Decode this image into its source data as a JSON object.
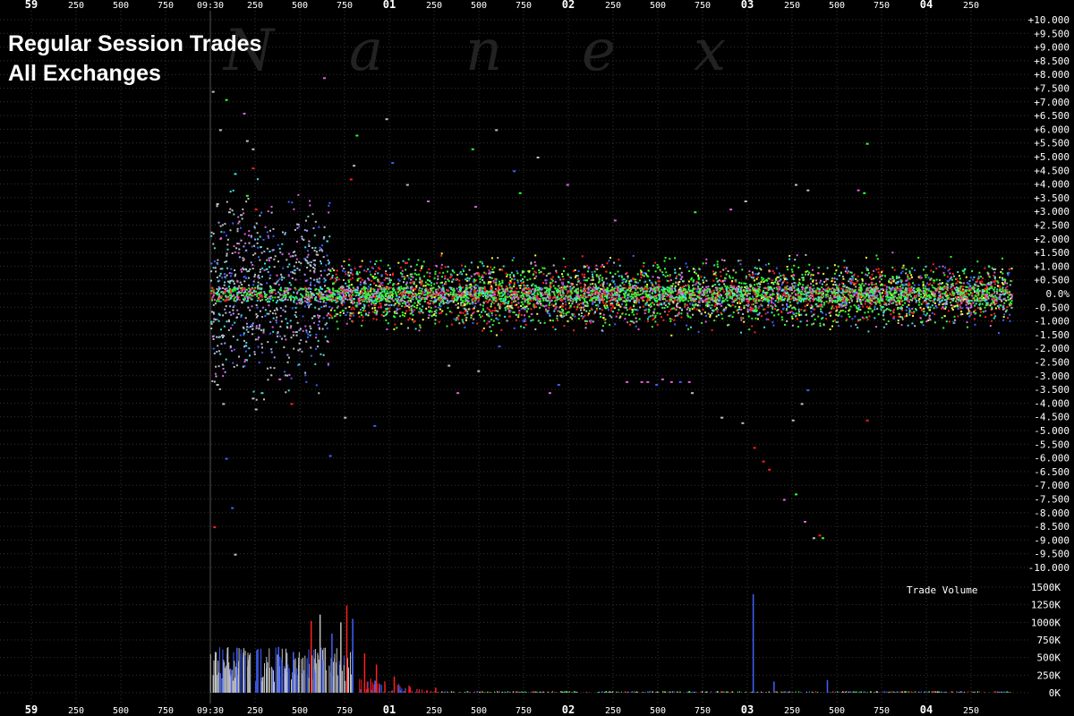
{
  "title_lines": [
    "Regular Session Trades",
    "All Exchanges"
  ],
  "watermark": [
    "N",
    "a",
    "n",
    "e",
    "x"
  ],
  "colors": {
    "background": "#000000",
    "grid": "#333333",
    "axis_text": "#ffffff",
    "trade_colors": [
      "#ff2020",
      "#30ff30",
      "#c0c0c0",
      "#4060ff",
      "#e060e0",
      "#40e0e0",
      "#ffff40",
      "#ff9030",
      "#a0a0ff"
    ]
  },
  "time_axis": {
    "labels": [
      {
        "text": "59",
        "bold": true
      },
      {
        "text": "250",
        "bold": false
      },
      {
        "text": "500",
        "bold": false
      },
      {
        "text": "750",
        "bold": false
      },
      {
        "text": "09:30",
        "bold": false
      },
      {
        "text": "250",
        "bold": false
      },
      {
        "text": "500",
        "bold": false
      },
      {
        "text": "750",
        "bold": false
      },
      {
        "text": "01",
        "bold": true
      },
      {
        "text": "250",
        "bold": false
      },
      {
        "text": "500",
        "bold": false
      },
      {
        "text": "750",
        "bold": false
      },
      {
        "text": "02",
        "bold": true
      },
      {
        "text": "250",
        "bold": false
      },
      {
        "text": "500",
        "bold": false
      },
      {
        "text": "750",
        "bold": false
      },
      {
        "text": "03",
        "bold": true
      },
      {
        "text": "250",
        "bold": false
      },
      {
        "text": "500",
        "bold": false
      },
      {
        "text": "750",
        "bold": false
      },
      {
        "text": "04",
        "bold": true
      },
      {
        "text": "250",
        "bold": false
      }
    ]
  },
  "chart_data": [
    {
      "type": "scatter",
      "title": "Regular Session Trades",
      "subtitle": "All Exchanges",
      "x_range_seconds_after_0930": [
        0,
        270
      ],
      "ylim": [
        -10,
        10
      ],
      "y_unit": "%",
      "y_tick_labels": [
        "+10.000",
        "+9.500",
        "+9.000",
        "+8.500",
        "+8.000",
        "+7.500",
        "+7.000",
        "+6.500",
        "+6.000",
        "+5.500",
        "+5.000",
        "+4.500",
        "+4.000",
        "+3.500",
        "+3.000",
        "+2.500",
        "+2.000",
        "+1.500",
        "+1.000",
        "+0.500",
        "0.0%",
        "-0.500",
        "-1.000",
        "-1.500",
        "-2.000",
        "-2.500",
        "-3.000",
        "-3.500",
        "-4.000",
        "-4.500",
        "-5.000",
        "-5.500",
        "-6.000",
        "-6.500",
        "-7.000",
        "-7.500",
        "-8.000",
        "-8.500",
        "-9.000",
        "-9.500",
        "-10.000"
      ],
      "grid": true,
      "points": [
        {
          "x": 0.5,
          "y": 7.4,
          "c": 2
        },
        {
          "x": 3,
          "y": 6.0,
          "c": 2
        },
        {
          "x": 5,
          "y": 7.1,
          "c": 1
        },
        {
          "x": 11,
          "y": 6.6,
          "c": 4
        },
        {
          "x": 12,
          "y": 5.6,
          "c": 2
        },
        {
          "x": 14,
          "y": 4.6,
          "c": 0
        },
        {
          "x": 14,
          "y": 5.3,
          "c": 2
        },
        {
          "x": 8,
          "y": 4.4,
          "c": 5
        },
        {
          "x": 2,
          "y": 3.3,
          "c": 2
        },
        {
          "x": 6,
          "y": 3.0,
          "c": 2
        },
        {
          "x": 10,
          "y": 2.9,
          "c": 2
        },
        {
          "x": 12,
          "y": 3.6,
          "c": 1
        },
        {
          "x": 15,
          "y": 3.1,
          "c": 0
        },
        {
          "x": 38,
          "y": 7.9,
          "c": 4
        },
        {
          "x": 47,
          "y": 4.2,
          "c": 0
        },
        {
          "x": 48,
          "y": 4.7,
          "c": 2
        },
        {
          "x": 49,
          "y": 5.8,
          "c": 1
        },
        {
          "x": 59,
          "y": 6.4,
          "c": 2
        },
        {
          "x": 61,
          "y": 4.8,
          "c": 3
        },
        {
          "x": 66,
          "y": 4.0,
          "c": 2
        },
        {
          "x": 73,
          "y": 3.4,
          "c": 4
        },
        {
          "x": 89,
          "y": 3.2,
          "c": 4
        },
        {
          "x": 88,
          "y": 5.3,
          "c": 1
        },
        {
          "x": 2,
          "y": -3.3,
          "c": 2
        },
        {
          "x": 4,
          "y": -4.0,
          "c": 2
        },
        {
          "x": 5,
          "y": -6.0,
          "c": 3
        },
        {
          "x": 7,
          "y": -7.8,
          "c": 3
        },
        {
          "x": 8,
          "y": -9.5,
          "c": 2
        },
        {
          "x": 1,
          "y": -8.5,
          "c": 0
        },
        {
          "x": 14,
          "y": -3.8,
          "c": 2
        },
        {
          "x": 15,
          "y": -4.2,
          "c": 2
        },
        {
          "x": 17,
          "y": -3.6,
          "c": 5
        },
        {
          "x": 23,
          "y": -3.1,
          "c": 4
        },
        {
          "x": 27,
          "y": -4.0,
          "c": 0
        },
        {
          "x": 40,
          "y": -5.9,
          "c": 3
        },
        {
          "x": 45,
          "y": -4.5,
          "c": 2
        },
        {
          "x": 55,
          "y": -4.8,
          "c": 3
        },
        {
          "x": 80,
          "y": -2.6,
          "c": 2
        },
        {
          "x": 83,
          "y": -3.6,
          "c": 4
        },
        {
          "x": 90,
          "y": -2.8,
          "c": 2
        },
        {
          "x": 97,
          "y": -1.9,
          "c": 3
        },
        {
          "x": 114,
          "y": -3.6,
          "c": 4
        },
        {
          "x": 117,
          "y": -3.3,
          "c": 3
        },
        {
          "x": 140,
          "y": -3.2,
          "c": 4
        },
        {
          "x": 145,
          "y": -3.2,
          "c": 4
        },
        {
          "x": 147,
          "y": -3.2,
          "c": 4
        },
        {
          "x": 150,
          "y": -3.3,
          "c": 3
        },
        {
          "x": 152,
          "y": -3.1,
          "c": 4
        },
        {
          "x": 155,
          "y": -3.2,
          "c": 4
        },
        {
          "x": 158,
          "y": -3.2,
          "c": 3
        },
        {
          "x": 161,
          "y": -3.2,
          "c": 4
        },
        {
          "x": 162,
          "y": -3.6,
          "c": 2
        },
        {
          "x": 172,
          "y": -4.5,
          "c": 2
        },
        {
          "x": 179,
          "y": -4.7,
          "c": 2
        },
        {
          "x": 183,
          "y": -5.6,
          "c": 0
        },
        {
          "x": 186,
          "y": -6.1,
          "c": 0
        },
        {
          "x": 188,
          "y": -6.4,
          "c": 0
        },
        {
          "x": 193,
          "y": -7.5,
          "c": 4
        },
        {
          "x": 197,
          "y": -7.3,
          "c": 1
        },
        {
          "x": 200,
          "y": -8.3,
          "c": 4
        },
        {
          "x": 203,
          "y": -8.9,
          "c": 2
        },
        {
          "x": 206,
          "y": -8.9,
          "c": 1
        },
        {
          "x": 205,
          "y": -8.8,
          "c": 0
        },
        {
          "x": 196,
          "y": -4.6,
          "c": 2
        },
        {
          "x": 199,
          "y": -4.0,
          "c": 2
        },
        {
          "x": 201,
          "y": -3.5,
          "c": 3
        },
        {
          "x": 221,
          "y": -4.6,
          "c": 0
        },
        {
          "x": 197,
          "y": 4.0,
          "c": 2
        },
        {
          "x": 201,
          "y": 3.8,
          "c": 2
        },
        {
          "x": 218,
          "y": 3.8,
          "c": 4
        },
        {
          "x": 220,
          "y": 3.7,
          "c": 1
        },
        {
          "x": 221,
          "y": 5.5,
          "c": 1
        },
        {
          "x": 180,
          "y": 3.4,
          "c": 2
        },
        {
          "x": 175,
          "y": 3.1,
          "c": 4
        },
        {
          "x": 163,
          "y": 3.0,
          "c": 1
        },
        {
          "x": 120,
          "y": 4.0,
          "c": 4
        },
        {
          "x": 110,
          "y": 5.0,
          "c": 2
        },
        {
          "x": 102,
          "y": 4.5,
          "c": 3
        },
        {
          "x": 96,
          "y": 6.0,
          "c": 2
        },
        {
          "x": 104,
          "y": 3.7,
          "c": 1
        },
        {
          "x": 136,
          "y": 2.7,
          "c": 4
        }
      ],
      "band_note": "dense cloud of trades within ±1.5% across the whole session; wider ±3.5% spread before 09:30:15"
    },
    {
      "type": "bar",
      "title": "Trade Volume",
      "y_unit": "shares",
      "ylim": [
        0,
        1500000
      ],
      "y_tick_labels": [
        "1500K",
        "1250K",
        "1000K",
        "750K",
        "500K",
        "250K",
        "0K"
      ],
      "spikes": [
        {
          "x": 9,
          "value": 640000,
          "c": 3
        },
        {
          "x": 16,
          "value": 620000,
          "c": 3
        },
        {
          "x": 23,
          "value": 650000,
          "c": 3
        },
        {
          "x": 28,
          "value": 580000,
          "c": 3
        },
        {
          "x": 34,
          "value": 1020000,
          "c": 0
        },
        {
          "x": 37,
          "value": 1110000,
          "c": 2
        },
        {
          "x": 41,
          "value": 840000,
          "c": 3
        },
        {
          "x": 44,
          "value": 1000000,
          "c": 2
        },
        {
          "x": 46,
          "value": 1240000,
          "c": 0
        },
        {
          "x": 48,
          "value": 1050000,
          "c": 3
        },
        {
          "x": 52,
          "value": 560000,
          "c": 0
        },
        {
          "x": 56,
          "value": 400000,
          "c": 0
        },
        {
          "x": 62,
          "value": 230000,
          "c": 0
        },
        {
          "x": 67,
          "value": 100000,
          "c": 0
        },
        {
          "x": 76,
          "value": 70000,
          "c": 0
        },
        {
          "x": 183,
          "value": 1400000,
          "c": 3
        },
        {
          "x": 190,
          "value": 160000,
          "c": 3
        },
        {
          "x": 208,
          "value": 180000,
          "c": 3
        }
      ]
    }
  ],
  "volume_label": "Trade Volume"
}
